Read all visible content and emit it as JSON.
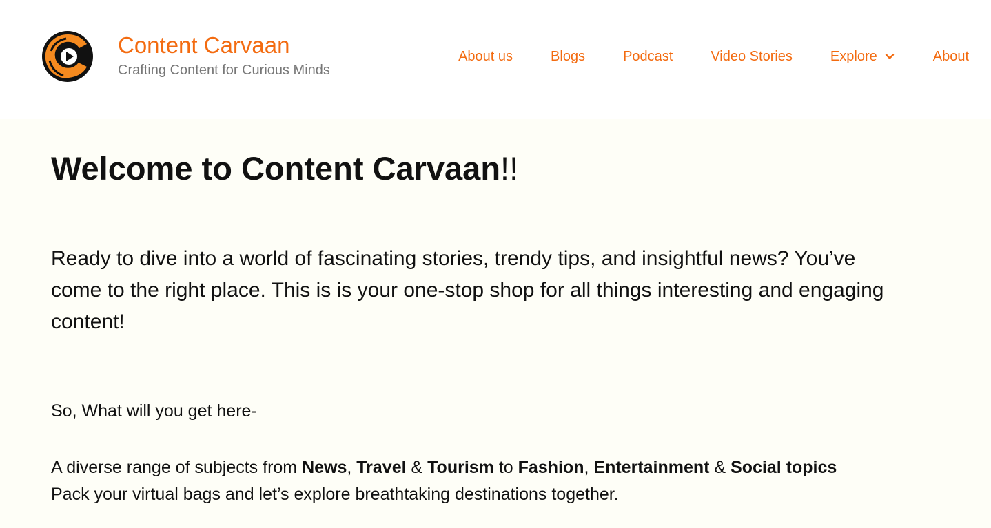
{
  "site": {
    "title": "Content Carvaan",
    "tagline": "Crafting Content for Curious Minds",
    "logo_icon": "play-triangle-icon",
    "brand_color": "#f36b10"
  },
  "nav": {
    "items": [
      {
        "label": "About us"
      },
      {
        "label": "Blogs"
      },
      {
        "label": "Podcast"
      },
      {
        "label": "Video Stories"
      },
      {
        "label": "Explore",
        "icon": "chevron-down-icon"
      },
      {
        "label": "About"
      }
    ]
  },
  "main": {
    "heading": "Welcome to Content Carvaan",
    "heading_suffix": "!!",
    "intro": "Ready to dive into a world of fascinating stories, trendy tips, and insightful news? You’ve come to the right place. This is is your one-stop shop for all things interesting and engaging content!",
    "what_heading": "So, What will you get here-",
    "subjects": {
      "prefix": "A diverse range of subjects from ",
      "news": "News",
      "sep1": ", ",
      "travel": "Travel",
      "amp1": " & ",
      "tourism": "Tourism",
      "to": " to ",
      "fashion": "Fashion",
      "sep2": ", ",
      "entertainment": "Entertainment",
      "amp2": " & ",
      "social": "Social topics"
    },
    "travel_line": "Pack your virtual bags and let’s explore breathtaking destinations together."
  },
  "colors": {
    "main_background": "#fefef7",
    "tagline": "#777777",
    "text": "#111111"
  }
}
